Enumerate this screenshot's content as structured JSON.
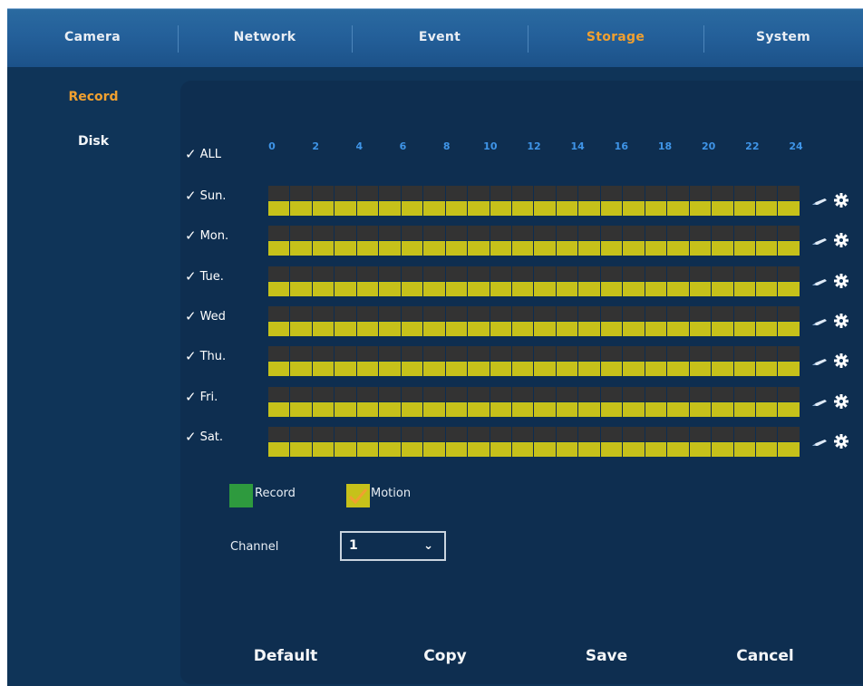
{
  "topnav": {
    "tabs": [
      {
        "label": "Camera",
        "active": false
      },
      {
        "label": "Network",
        "active": false
      },
      {
        "label": "Event",
        "active": false
      },
      {
        "label": "Storage",
        "active": true
      },
      {
        "label": "System",
        "active": false
      }
    ]
  },
  "sidebar": {
    "items": [
      {
        "label": "Record",
        "active": true
      },
      {
        "label": "Disk",
        "active": false
      }
    ]
  },
  "schedule": {
    "all_label": "ALL",
    "hours": [
      "0",
      "2",
      "4",
      "6",
      "8",
      "10",
      "12",
      "14",
      "16",
      "18",
      "20",
      "22",
      "24"
    ],
    "days": [
      {
        "label": "Sun.",
        "checked": true
      },
      {
        "label": "Mon.",
        "checked": true
      },
      {
        "label": "Tue.",
        "checked": true
      },
      {
        "label": "Wed",
        "checked": true
      },
      {
        "label": "Thu.",
        "checked": true
      },
      {
        "label": "Fri.",
        "checked": true
      },
      {
        "label": "Sat.",
        "checked": true
      }
    ],
    "row_icons": [
      "pen-icon",
      "gear-icon"
    ]
  },
  "legend": {
    "record_label": "Record",
    "motion_label": "Motion",
    "record_color": "#2e9a3e",
    "motion_color": "#c6c11a"
  },
  "colors": {
    "active_tab": "#f0a030",
    "record_off": "#333333",
    "motion_on": "#c6c11a",
    "hour_label": "#3f95e8"
  },
  "channel": {
    "label": "Channel",
    "value": "1"
  },
  "buttons": {
    "default": "Default",
    "copy": "Copy",
    "save": "Save",
    "cancel": "Cancel"
  }
}
